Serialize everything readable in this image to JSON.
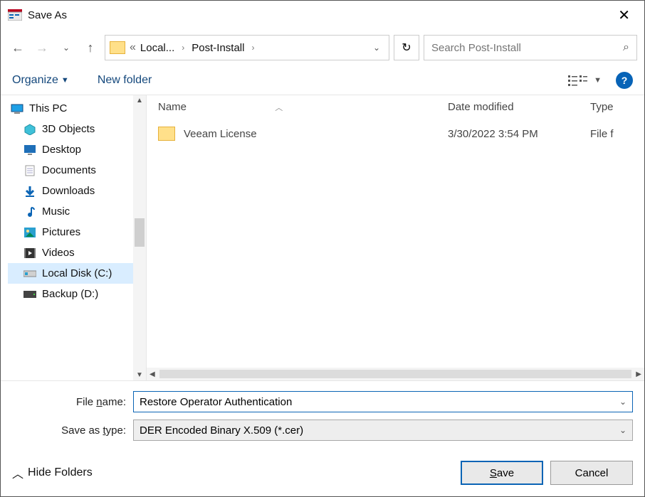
{
  "title": "Save As",
  "breadcrumb": {
    "prefix": "«",
    "seg1": "Local...",
    "seg2": "Post-Install"
  },
  "search": {
    "placeholder": "Search Post-Install"
  },
  "toolbar": {
    "organize": "Organize",
    "newfolder": "New folder"
  },
  "tree": {
    "thispc": "This PC",
    "objects3d": "3D Objects",
    "desktop": "Desktop",
    "documents": "Documents",
    "downloads": "Downloads",
    "music": "Music",
    "pictures": "Pictures",
    "videos": "Videos",
    "localdisk": "Local Disk (C:)",
    "backup": "Backup (D:)"
  },
  "list": {
    "headers": {
      "name": "Name",
      "date": "Date modified",
      "type": "Type"
    },
    "rows": [
      {
        "name": "Veeam License",
        "date": "3/30/2022 3:54 PM",
        "type": "File f"
      }
    ]
  },
  "filename": {
    "label_pre": "File ",
    "label_u": "n",
    "label_post": "ame:",
    "value": "Restore Operator Authentication"
  },
  "filetype": {
    "label_pre": "Save as ",
    "label_u": "t",
    "label_post": "ype:",
    "value": "DER Encoded Binary X.509 (*.cer)"
  },
  "hidefolders": "Hide Folders",
  "buttons": {
    "save_pre": "",
    "save_u": "S",
    "save_post": "ave",
    "cancel": "Cancel"
  }
}
